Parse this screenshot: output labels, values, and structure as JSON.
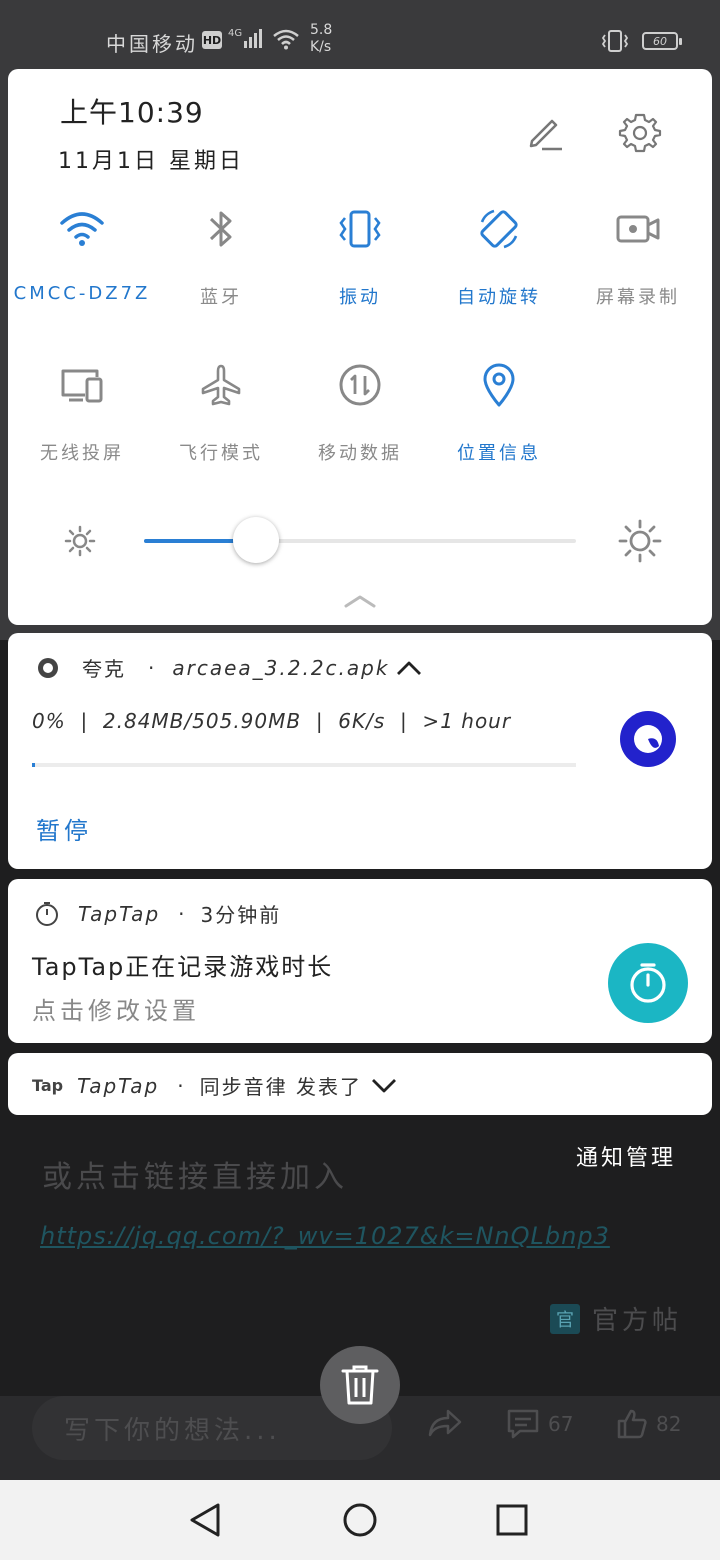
{
  "status_bar": {
    "carrier": "中国移动",
    "hd": "HD",
    "network": "4G",
    "speed_value": "5.8",
    "speed_unit": "K/s",
    "battery": "60"
  },
  "quick_settings": {
    "time": "上午10:39",
    "date": "11月1日 星期日",
    "tiles": [
      {
        "label": "CMCC-DZ7Z",
        "icon": "wifi-icon",
        "active": true
      },
      {
        "label": "蓝牙",
        "icon": "bluetooth-icon",
        "active": false
      },
      {
        "label": "振动",
        "icon": "vibrate-icon",
        "active": true
      },
      {
        "label": "自动旋转",
        "icon": "auto-rotate-icon",
        "active": true
      },
      {
        "label": "屏幕录制",
        "icon": "screen-record-icon",
        "active": false
      },
      {
        "label": "无线投屏",
        "icon": "wireless-projection-icon",
        "active": false
      },
      {
        "label": "飞行模式",
        "icon": "airplane-icon",
        "active": false
      },
      {
        "label": "移动数据",
        "icon": "mobile-data-icon",
        "active": false
      },
      {
        "label": "位置信息",
        "icon": "location-icon",
        "active": true
      }
    ],
    "brightness_level": 0.26
  },
  "download_notification": {
    "app": "夸克",
    "separator": "·",
    "filename": "arcaea_3.2.2c.apk",
    "progress_text": "0%  |  2.84MB/505.90MB  |  6K/s  |  >1 hour",
    "progress_fraction": 0.005,
    "pause_label": "暂停"
  },
  "taptap_notification": {
    "app": "TapTap",
    "separator": "·",
    "time": "3分钟前",
    "title": "TapTap正在记录游戏时长",
    "subtitle": "点击修改设置"
  },
  "taptap_collapsed": {
    "logo_text": "Tap",
    "app": "TapTap",
    "separator": "·",
    "text": "同步音律 发表了"
  },
  "notification_manage": "通知管理",
  "background": {
    "line": "或点击链接直接加入",
    "link": "https://jq.qq.com/?_wv=1027&k=NnQLbnp3",
    "official_badge": "官",
    "official_text": "官方帖",
    "comment_placeholder": "写下你的想法...",
    "comment_count": "67",
    "like_count": "82"
  },
  "colors": {
    "accent": "#2a7fd4",
    "active_label": "#2277cc",
    "quark_blue": "#2222cc",
    "taptap_teal": "#1bb6c4"
  }
}
